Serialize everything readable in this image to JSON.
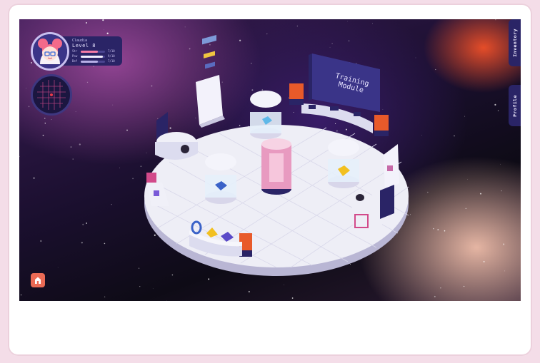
{
  "player": {
    "name": "Claudia",
    "level": "Level 8",
    "stats": [
      {
        "label": "Str",
        "value": "7/10",
        "fill": 0.7,
        "color": "#f47ca6"
      },
      {
        "label": "Pow",
        "value": "9/10",
        "fill": 0.9,
        "color": "#f2f0ff"
      },
      {
        "label": "Def",
        "value": "7/10",
        "fill": 0.7,
        "color": "#b7b0e8"
      }
    ]
  },
  "tabs": {
    "inventory": "Inventory",
    "profile": "Profile"
  },
  "scene": {
    "sign_text_line1": "Training",
    "sign_text_line2": "Module"
  },
  "icons": {
    "home": "home-icon",
    "avatar": "avatar-icon",
    "minimap": "minimap-icon"
  },
  "colors": {
    "hud": "#2a2466",
    "accent": "#ea6a55",
    "platform": "#eeeef6",
    "crate": "#e85a2a",
    "pillar": "#e89ac0"
  }
}
